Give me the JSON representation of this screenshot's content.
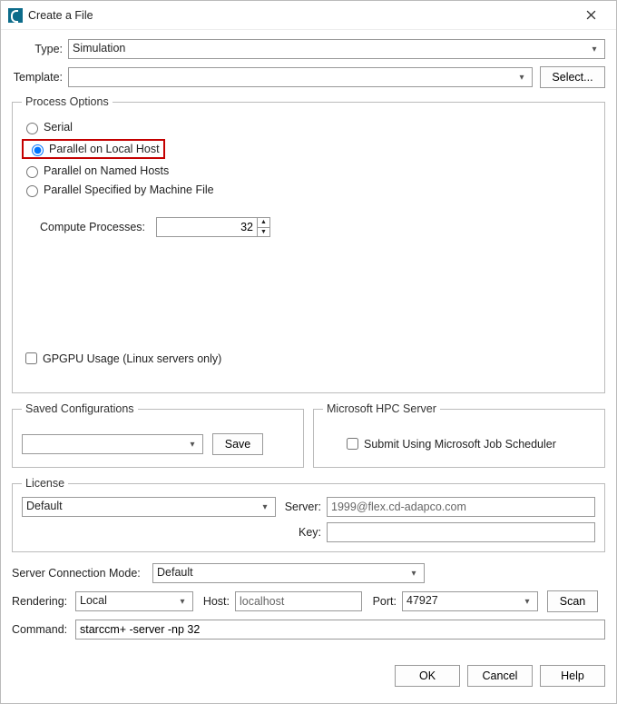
{
  "window": {
    "title": "Create a File"
  },
  "type": {
    "label": "Type:",
    "value": "Simulation"
  },
  "template": {
    "label": "Template:",
    "value": "",
    "select_button": "Select..."
  },
  "process": {
    "legend": "Process Options",
    "options": {
      "serial": "Serial",
      "parallel_local": "Parallel on Local Host",
      "parallel_named": "Parallel on Named Hosts",
      "parallel_file": "Parallel Specified by Machine File"
    },
    "selected": "parallel_local",
    "compute_label": "Compute Processes:",
    "compute_value": "32",
    "gpgpu_label": "GPGPU Usage (Linux servers only)"
  },
  "saved": {
    "legend": "Saved Configurations",
    "save_button": "Save",
    "value": ""
  },
  "hpc": {
    "legend": "Microsoft HPC Server",
    "checkbox": "Submit Using Microsoft Job Scheduler"
  },
  "license": {
    "legend": "License",
    "value": "Default",
    "server_label": "Server:",
    "server_value": "1999@flex.cd-adapco.com",
    "key_label": "Key:",
    "key_value": ""
  },
  "conn_mode": {
    "label": "Server Connection Mode:",
    "value": "Default"
  },
  "rendering": {
    "label": "Rendering:",
    "value": "Local",
    "host_label": "Host:",
    "host_value": "localhost",
    "port_label": "Port:",
    "port_value": "47927",
    "scan_button": "Scan"
  },
  "command": {
    "label": "Command:",
    "value": "starccm+ -server -np 32"
  },
  "buttons": {
    "ok": "OK",
    "cancel": "Cancel",
    "help": "Help"
  }
}
